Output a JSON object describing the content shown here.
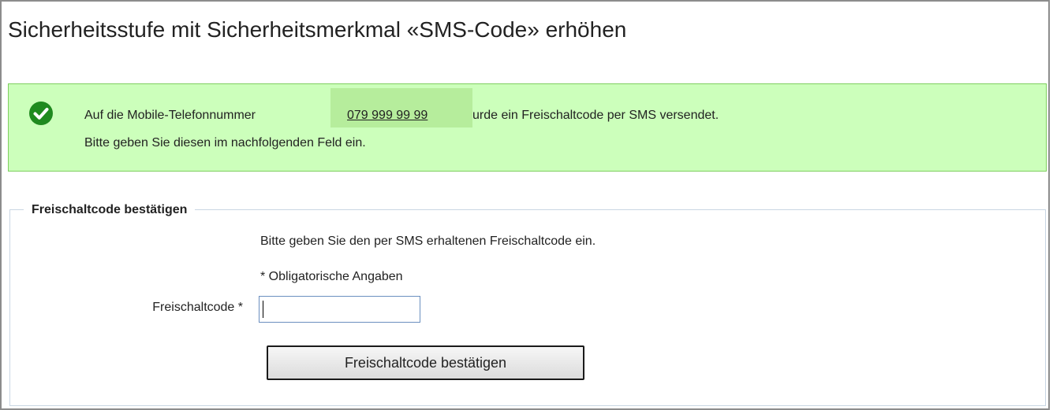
{
  "page": {
    "title": "Sicherheitsstufe mit Sicherheitsmerkmal «SMS-Code» erhöhen"
  },
  "notification": {
    "type": "success",
    "icon": "checkmark-circle-icon",
    "line1_prefix": "Auf die Mobile-Telefonnummer",
    "phone_number": "079 999 99 99",
    "line1_suffix": "urde ein Freischaltcode per SMS versendet.",
    "line2": "Bitte geben Sie diesen im nachfolgenden Feld ein.",
    "colors": {
      "background": "#ccffbb",
      "border": "#7fcf5f",
      "icon": "#1f8a1f",
      "highlight": "#b6ed9c"
    }
  },
  "form": {
    "legend": "Freischaltcode bestätigen",
    "instruction": "Bitte geben Sie den per SMS erhaltenen Freischaltcode ein.",
    "required_note": "* Obligatorische Angaben",
    "code_field": {
      "label": "Freischaltcode *",
      "value": "",
      "placeholder": ""
    },
    "submit_label": "Freischaltcode bestätigen"
  }
}
